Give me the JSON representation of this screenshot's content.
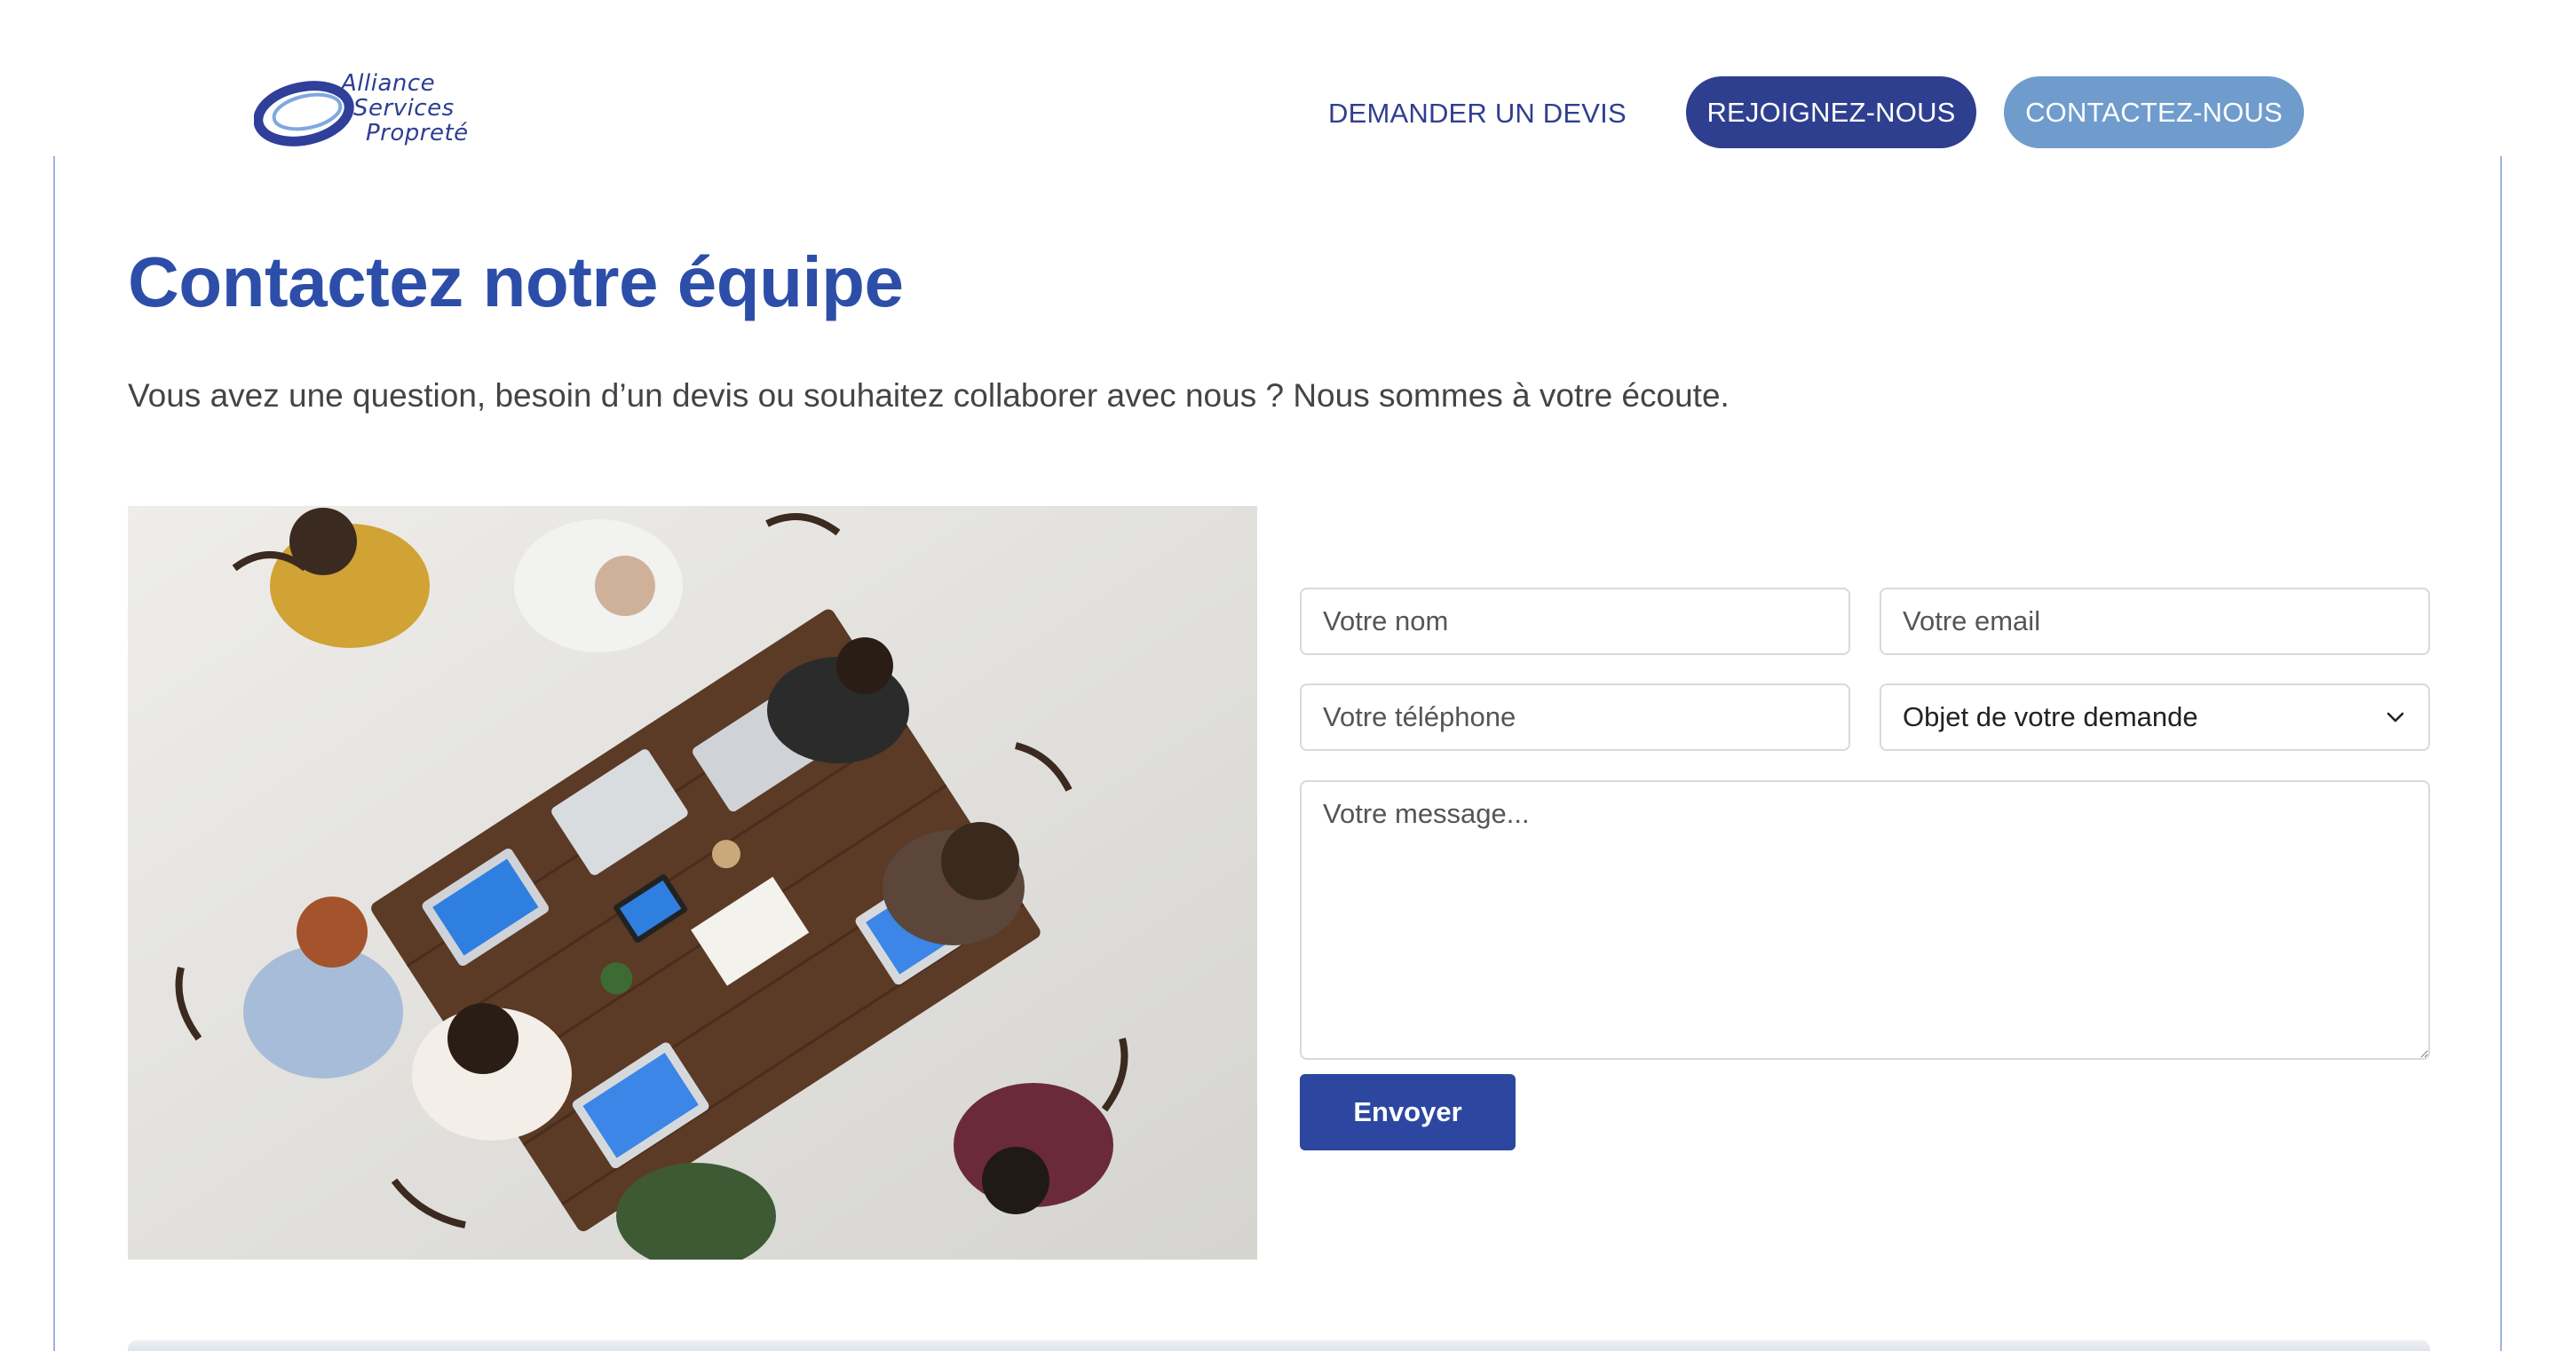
{
  "header": {
    "logo": {
      "line1": "Alliance",
      "line2": "Services",
      "line3": "Propreté"
    },
    "nav": {
      "quote_link": "DEMANDER UN DEVIS",
      "join_button": "REJOIGNEZ-NOUS",
      "contact_button": "CONTACTEZ-NOUS"
    }
  },
  "main": {
    "title": "Contactez notre équipe",
    "subtitle": "Vous avez une question, besoin d’un devis ou souhaitez collaborer avec nous ? Nous sommes à votre écoute."
  },
  "form": {
    "name_placeholder": "Votre nom",
    "email_placeholder": "Votre email",
    "phone_placeholder": "Votre téléphone",
    "subject_selected": "Objet de votre demande",
    "message_placeholder": "Votre message...",
    "submit_label": "Envoyer"
  },
  "colors": {
    "primary": "#2d4ea8",
    "nav_dark": "#2f3f8f",
    "nav_light": "#6f9ccd"
  },
  "icons": {
    "select": "chevron-down-icon",
    "resize": "resize-handle-icon"
  }
}
